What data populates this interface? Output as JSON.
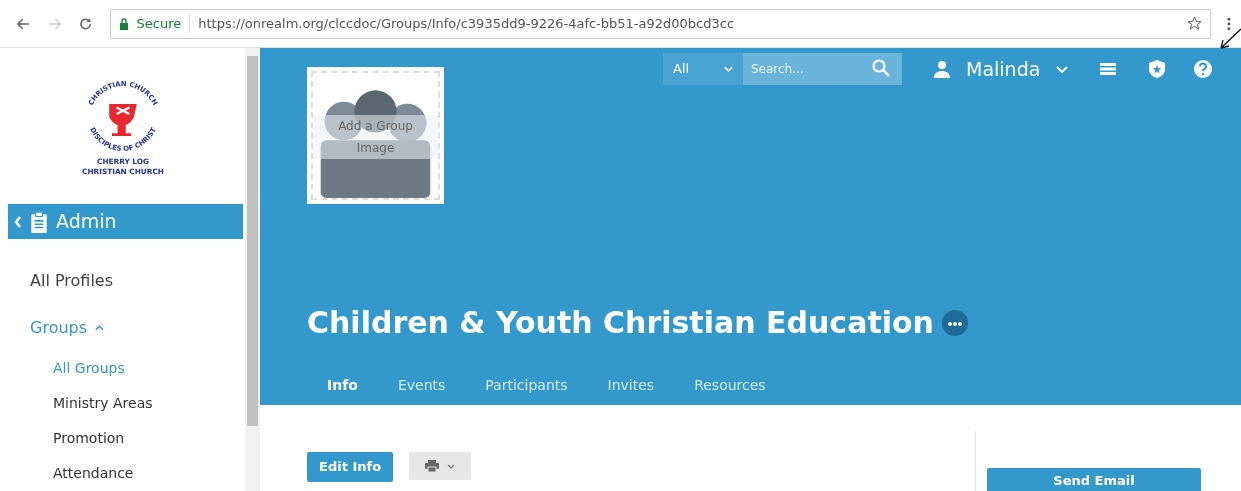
{
  "browser": {
    "secure_label": "Secure",
    "url": "https://onrealm.org/clccdoc/Groups/Info/c3935dd9-9226-4afc-bb51-a92d00bcd3cc"
  },
  "logo": {
    "ring_top": "CHRISTIAN CHURCH",
    "ring_bottom": "DISCIPLES OF CHRIST",
    "name_lines": [
      "CHERRY LOG",
      "CHRISTIAN CHURCH"
    ]
  },
  "sidebar": {
    "header": "Admin",
    "items": [
      {
        "label": "All Profiles",
        "selected": false
      },
      {
        "label": "Groups",
        "selected": true,
        "expanded": true,
        "children": [
          {
            "label": "All Groups",
            "selected": true
          },
          {
            "label": "Ministry Areas",
            "selected": false
          },
          {
            "label": "Promotion",
            "selected": false
          },
          {
            "label": "Attendance",
            "selected": false
          }
        ]
      }
    ]
  },
  "topbar": {
    "scope": "All",
    "search": {
      "placeholder": "Search..."
    },
    "user": "Malinda"
  },
  "group": {
    "image_placeholder": "Add a Group Image",
    "title": "Children & Youth Christian Education"
  },
  "tabs": [
    {
      "label": "Info",
      "selected": true
    },
    {
      "label": "Events",
      "selected": false
    },
    {
      "label": "Participants",
      "selected": false
    },
    {
      "label": "Invites",
      "selected": false
    },
    {
      "label": "Resources",
      "selected": false
    }
  ],
  "actions": {
    "edit": "Edit Info",
    "send_email": "Send Email"
  }
}
